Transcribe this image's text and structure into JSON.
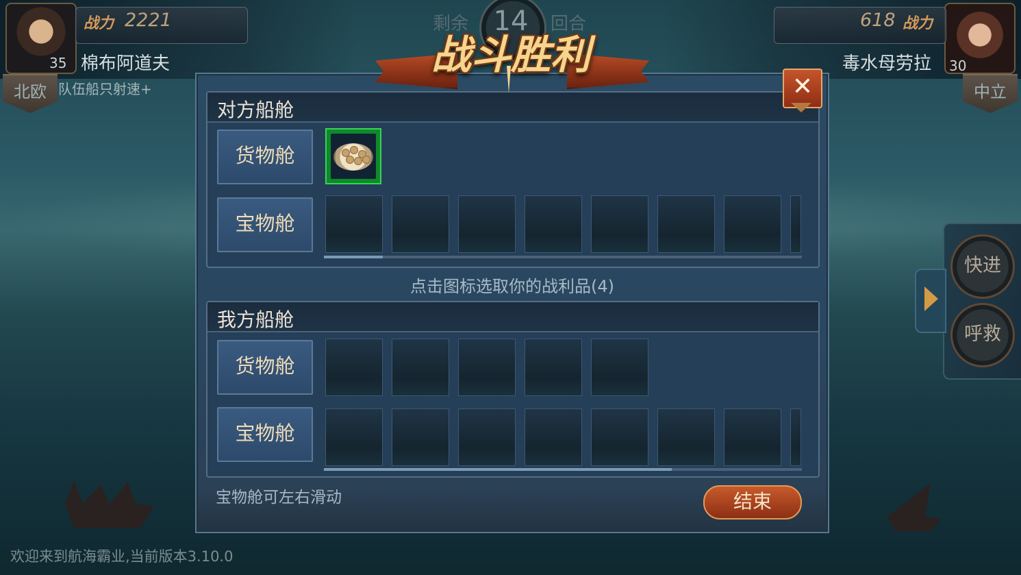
{
  "hud": {
    "left_player": {
      "power_label": "战力",
      "power": "2221",
      "name": "棉布阿道夫",
      "level": "35",
      "faction": "北欧",
      "buff": "队伍船只射速+"
    },
    "right_player": {
      "power_label": "战力",
      "power": "618",
      "name": "毒水母劳拉",
      "level": "30",
      "faction": "中立"
    },
    "round": {
      "left_label": "剩余",
      "value": "14",
      "right_label": "回合"
    }
  },
  "side_buttons": {
    "fast_forward": "快进",
    "call_help": "呼救"
  },
  "dialog": {
    "banner_title": "战斗胜利",
    "close_glyph": "✕",
    "enemy_section": {
      "title": "对方船舱",
      "cargo_label": "货物舱",
      "treasure_label": "宝物舱",
      "cargo_items": [
        {
          "icon": "food-plate-icon"
        }
      ],
      "treasure_slots_visible": 7
    },
    "hint": "点击图标选取你的战利品(4)",
    "my_section": {
      "title": "我方船舱",
      "cargo_label": "货物舱",
      "treasure_label": "宝物舱",
      "cargo_slots": 5,
      "treasure_slots_visible": 7
    },
    "footer_hint": "宝物舱可左右滑动",
    "end_button": "结束"
  },
  "welcome": "欢迎来到航海霸业,当前版本3.10.0",
  "colors": {
    "accent": "#c65a2b",
    "item_border": "#3ad25a",
    "dialog_bg": "#2b4a63"
  }
}
